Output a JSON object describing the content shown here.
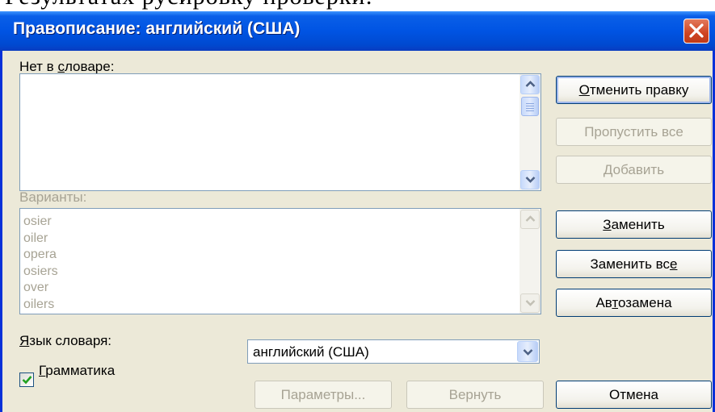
{
  "cropped_text": "Результатах русировку проверки:",
  "dialog": {
    "title": "Правописание: английский (США)",
    "close_label": "close"
  },
  "not_in_dictionary": {
    "label": "Нет в словаре:",
    "value": ""
  },
  "suggestions": {
    "label": "Варианты:",
    "items": [
      "osier",
      "oiler",
      "opera",
      "osiers",
      "over",
      "oilers"
    ]
  },
  "dictionary_language": {
    "label": "Язык словаря:",
    "value": "английский (США)"
  },
  "grammar": {
    "label": "Грамматика",
    "checked": true
  },
  "buttons": {
    "undo_edit": "Отменить правку",
    "ignore_all": "Пропустить все",
    "add": "Добавить",
    "change": "Заменить",
    "change_all": "Заменить все",
    "autocorrect": "Автозамена",
    "options": "Параметры...",
    "undo": "Вернуть",
    "cancel": "Отмена"
  },
  "colors": {
    "title_bar": "#0054e3",
    "dialog_face": "#ece9d8",
    "close_button": "#cf4422",
    "disabled_text": "#a7a394",
    "checkmark": "#21a121"
  }
}
